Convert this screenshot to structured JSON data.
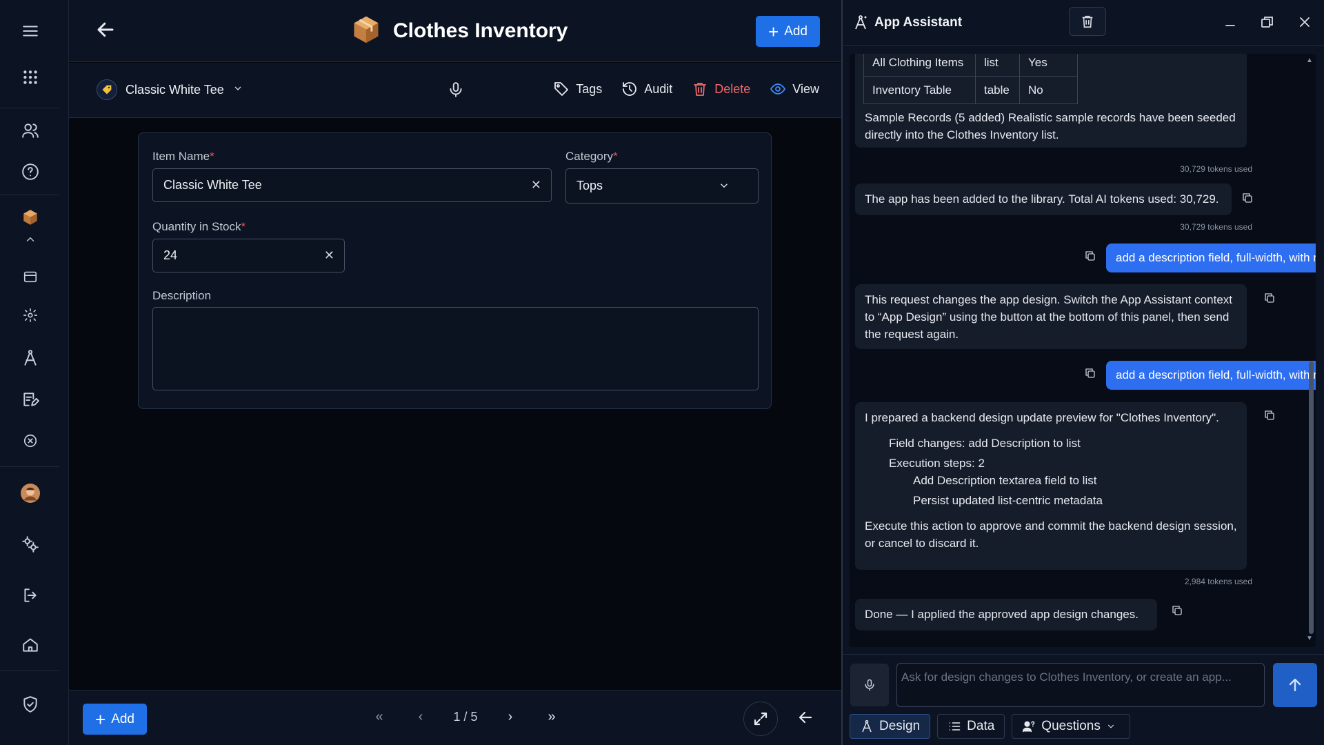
{
  "main": {
    "title": "Clothes Inventory",
    "add_label": "Add",
    "record": {
      "name": "Classic White Tee"
    },
    "toolbar": {
      "tags": "Tags",
      "audit": "Audit",
      "delete": "Delete",
      "view": "View"
    },
    "form": {
      "item_name_label": "Item Name",
      "item_name_value": "Classic White Tee",
      "category_label": "Category",
      "category_value": "Tops",
      "qty_label": "Quantity in Stock",
      "qty_value": "24",
      "desc_label": "Description",
      "required_mark": "*"
    },
    "footer": {
      "add_label": "Add",
      "page": "1 / 5"
    }
  },
  "assistant": {
    "title": "App Assistant",
    "table_rows": [
      [
        "All Clothing Items",
        "list",
        "Yes"
      ],
      [
        "Inventory Table",
        "table",
        "No"
      ]
    ],
    "m1": "Sample Records (5 added) Realistic sample records have been seeded directly into the Clothes Inventory list.",
    "tok1": "30,729 tokens used",
    "m2": "The app has been added to the library. Total AI tokens used: 30,729.",
    "tok2": "30,729 tokens used",
    "u1": "add a description field, full-width, with multi-line text editing",
    "m3": "This request changes the app design. Switch the App Assistant context to “App Design” using the button at the bottom of this panel, then send the request again.",
    "u2": "add a description field, full-width, with multi-line text editing",
    "m4_intro": "I prepared a backend design update preview for \"Clothes Inventory\".",
    "m4_field": "Field changes: add Description to list",
    "m4_exec": "Execution steps: 2",
    "m4_step1": "Add Description textarea field to list",
    "m4_step2": "Persist updated list-centric metadata",
    "m4_outro": "Execute this action to approve and commit the backend design session, or cancel to discard it.",
    "tok3": "2,984 tokens used",
    "m5": "Done — I applied the approved app design changes.",
    "input_placeholder": "Ask for design changes to Clothes Inventory, or create an app...",
    "tabs": {
      "design": "Design",
      "data": "Data",
      "questions": "Questions"
    }
  },
  "colors": {
    "accent": "#1f6fe6",
    "delete": "#f26a6a",
    "required": "#ef4e4e"
  }
}
